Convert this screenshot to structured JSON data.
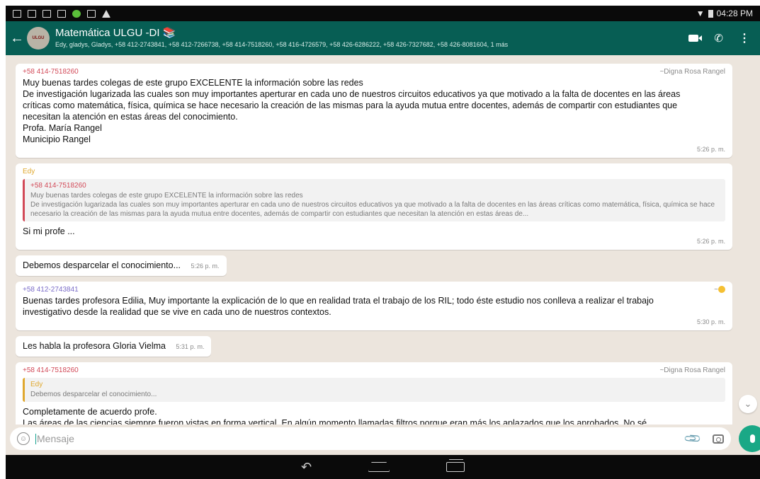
{
  "status": {
    "time": "04:28 PM"
  },
  "header": {
    "title": "Matemática ULGU -DI 📚",
    "members": "Edy, gladys, Gladys, +58 412-2743841, +58 412-7266738, +58 414-7518260, +58 416-4726579, +58 426-6286222, +58 426-7327682, +58 426-8081604, 1 más",
    "avatar_text": "ULGU"
  },
  "messages": [
    {
      "sender": "+58 414-7518260",
      "push_name": "~Digna Rosa Rangel",
      "text": "Muy buenas tardes colegas de este grupo EXCELENTE la información sobre las redes\nDe investigación lugarizada las cuales son muy importantes aperturar en cada uno de nuestros circuitos educativos ya que motivado a la falta de docentes en las áreas críticas como matemática, física, química se hace necesario la creación de las mismas para la ayuda mutua entre docentes, además de compartir con estudiantes que necesitan la atención en estas áreas del conocimiento.\nProfa. María Rangel\nMunicipio Rangel",
      "time": "5:26 p. m."
    },
    {
      "sender": "Edy",
      "quote_sender": "+58 414-7518260",
      "quote_text": "Muy buenas tardes colegas de este grupo EXCELENTE la información sobre las redes\nDe investigación lugarizada las cuales son muy importantes aperturar en cada uno de nuestros circuitos educativos ya que motivado a la falta de docentes en las áreas críticas como matemática, física, química se hace necesario la creación de las mismas para la ayuda mutua entre docentes, además de compartir con estudiantes que necesitan la atención en estas áreas de...",
      "text": "Si mi profe ...",
      "time": "5:26 p. m."
    },
    {
      "text": "Debemos desparcelar el conocimiento...",
      "time": "5:26 p. m."
    },
    {
      "sender": "+58 412-2743841",
      "push_name": "~",
      "text": "Buenas tardes profesora Edilia, Muy importante la explicación de lo que en realidad trata el trabajo de los RIL; todo éste estudio nos conlleva a realizar el trabajo investigativo desde la realidad que se vive en cada uno de nuestros contextos.",
      "time": "5:30 p. m."
    },
    {
      "text": "Les habla la profesora Gloria Vielma",
      "time": "5:31 p. m."
    },
    {
      "sender": "+58 414-7518260",
      "push_name": "~Digna Rosa Rangel",
      "quote_sender": "Edy",
      "quote_text": "Debemos desparcelar el conocimiento...",
      "text": "Completamente de acuerdo profe.\nLas áreas de las ciencias siempre fueron vistas en forma vertical. En algún momento llamadas filtros porque eran más los aplazados que los aprobados. No sé contextualizada el conocimiento.\nY preguntas frecuentes como ¿ Y para qué aprendo ese tema? ¿ Para qué me va ha servir en la vida?"
    }
  ],
  "composer": {
    "placeholder": "Mensaje"
  }
}
